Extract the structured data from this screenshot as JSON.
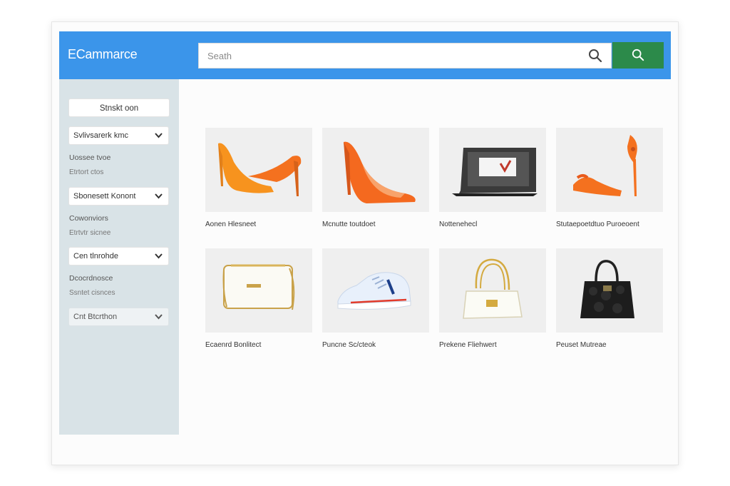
{
  "header": {
    "brand": "ECammarce",
    "search_placeholder": "Seath"
  },
  "sidebar": {
    "top_button": "Stnskt oon",
    "dropdowns": [
      {
        "label": "Svlivsarerk kmc"
      },
      {
        "label": "Sbonesett Konont"
      },
      {
        "label": "Cen tlnrohde"
      },
      {
        "label": "Cnt Btcrthon"
      }
    ],
    "groups": [
      {
        "title": "Uossee tvoe",
        "sub": "Etrtort ctos"
      },
      {
        "title": "Cowonviors",
        "sub": "Etrtvtr sicnee"
      },
      {
        "title": "Dcocrdnosce",
        "sub": "Ssntet cisnces"
      }
    ]
  },
  "products": [
    {
      "name": "Aonen Hlesneet",
      "image": "orange-heel-icon"
    },
    {
      "name": "Mcnutte toutdoet",
      "image": "orange-pump-icon"
    },
    {
      "name": "Nottenehecl",
      "image": "tablet-icon"
    },
    {
      "name": "Stutaepoetdtuo Puroeoent",
      "image": "orange-sandal-icon"
    },
    {
      "name": "Ecaenrd Bonlitect",
      "image": "white-clutch-icon"
    },
    {
      "name": "Puncne Sc/cteok",
      "image": "white-sneaker-icon"
    },
    {
      "name": "Prekene Fliehwert",
      "image": "white-handbag-icon"
    },
    {
      "name": "Peuset Mutreae",
      "image": "black-handbag-icon"
    }
  ],
  "colors": {
    "header": "#3b95ea",
    "search_button": "#2c8a4a",
    "sidebar": "#d9e3e7",
    "accent_orange": "#f4711f"
  }
}
